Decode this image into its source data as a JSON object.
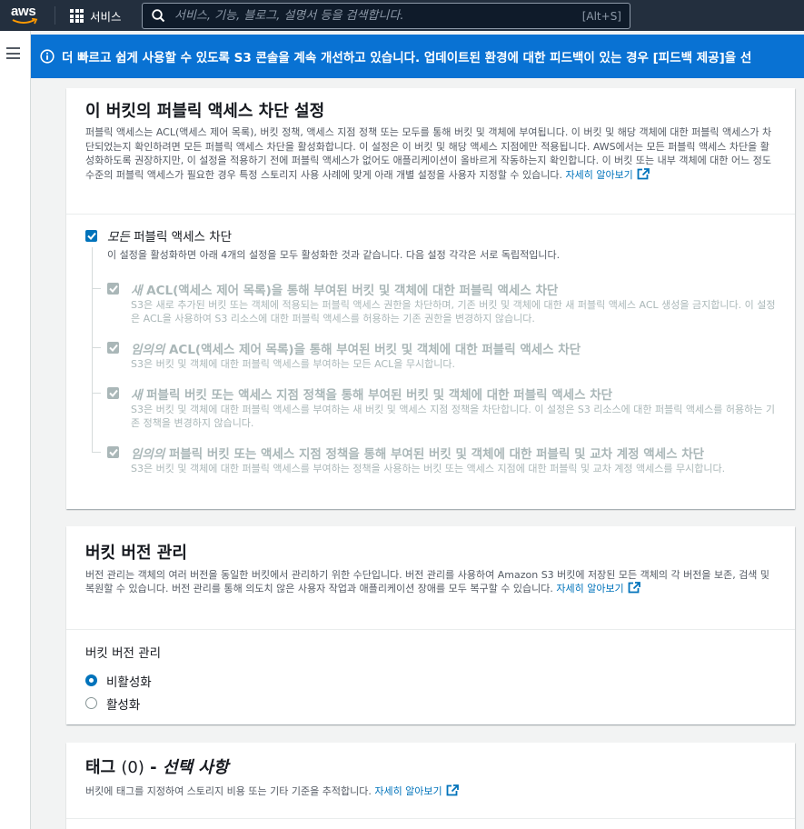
{
  "nav": {
    "logo_text": "aws",
    "services_label": "서비스",
    "search_placeholder": "서비스, 기능, 블로그, 설명서 등을 검색합니다.",
    "search_shortcut": "[Alt+S]"
  },
  "banner": {
    "text": "더 빠르고 쉽게 사용할 수 있도록 S3 콘솔을 계속 개선하고 있습니다. 업데이트된 환경에 대한 피드백이 있는 경우 [피드백 제공]을 선"
  },
  "block_public_access": {
    "title": "이 버킷의 퍼블릭 액세스 차단 설정",
    "description": "퍼블릭 액세스는 ACL(액세스 제어 목록), 버킷 정책, 액세스 지점 정책 또는 모두를 통해 버킷 및 객체에 부여됩니다. 이 버킷 및 해당 객체에 대한 퍼블릭 액세스가 차단되었는지 확인하려면 모든 퍼블릭 액세스 차단을 활성화합니다. 이 설정은 이 버킷 및 해당 액세스 지점에만 적용됩니다. AWS에서는 모든 퍼블릭 액세스 차단을 활성화하도록 권장하지만, 이 설정을 적용하기 전에 퍼블릭 액세스가 없어도 애플리케이션이 올바르게 작동하는지 확인합니다. 이 버킷 또는 내부 객체에 대한 어느 정도 수준의 퍼블릭 액세스가 필요한 경우 특정 스토리지 사용 사례에 맞게 아래 개별 설정을 사용자 지정할 수 있습니다.",
    "learn_more": "자세히 알아보기",
    "main_checkbox": {
      "label_em": "모든",
      "label_rest": " 퍼블릭 액세스 차단",
      "sub": "이 설정을 활성화하면 아래 4개의 설정을 모두 활성화한 것과 같습니다. 다음 설정 각각은 서로 독립적입니다.",
      "checked": true
    },
    "options": [
      {
        "title_em": "새",
        "title_rest": " ACL(액세스 제어 목록)을 통해 부여된 버킷 및 객체에 대한 퍼블릭 액세스 차단",
        "description": "S3은 새로 추가된 버킷 또는 객체에 적용되는 퍼블릭 액세스 권한을 차단하며, 기존 버킷 및 객체에 대한 새 퍼블릭 액세스 ACL 생성을 금지합니다. 이 설정은 ACL을 사용하여 S3 리소스에 대한 퍼블릭 액세스를 허용하는 기존 권한을 변경하지 않습니다."
      },
      {
        "title_em": "임의의",
        "title_rest": " ACL(액세스 제어 목록)을 통해 부여된 버킷 및 객체에 대한 퍼블릭 액세스 차단",
        "description": "S3은 버킷 및 객체에 대한 퍼블릭 액세스를 부여하는 모든 ACL을 무시합니다."
      },
      {
        "title_em": "새",
        "title_rest": " 퍼블릭 버킷 또는 액세스 지점 정책을 통해 부여된 버킷 및 객체에 대한 퍼블릭 액세스 차단",
        "description": "S3은 버킷 및 객체에 대한 퍼블릭 액세스를 부여하는 새 버킷 및 액세스 지점 정책을 차단합니다. 이 설정은 S3 리소스에 대한 퍼블릭 액세스를 허용하는 기존 정책을 변경하지 않습니다."
      },
      {
        "title_em": "임의의",
        "title_rest": " 퍼블릭 버킷 또는 액세스 지점 정책을 통해 부여된 버킷 및 객체에 대한 퍼블릭 및 교차 계정 액세스 차단",
        "description": "S3은 버킷 및 객체에 대한 퍼블릭 액세스를 부여하는 정책을 사용하는 버킷 또는 액세스 지점에 대한 퍼블릭 및 교차 계정 액세스를 무시합니다."
      }
    ]
  },
  "versioning": {
    "title": "버킷 버전 관리",
    "description": "버전 관리는 객체의 여러 버전을 동일한 버킷에서 관리하기 위한 수단입니다. 버전 관리를 사용하여 Amazon S3 버킷에 저장된 모든 객체의 각 버전을 보존, 검색 및 복원할 수 있습니다. 버전 관리를 통해 의도치 않은 사용자 작업과 애플리케이션 장애를 모두 복구할 수 있습니다.",
    "learn_more": "자세히 알아보기",
    "field_label": "버킷 버전 관리",
    "options": [
      "비활성화",
      "활성화"
    ],
    "selected": "비활성화"
  },
  "tags": {
    "title": "태그",
    "count": "(0)",
    "optional_dash": " - ",
    "optional": "선택 사항",
    "description": "버킷에 태그를 지정하여 스토리지 비용 또는 기타 기준을 추적합니다.",
    "learn_more": "자세히 알아보기"
  }
}
